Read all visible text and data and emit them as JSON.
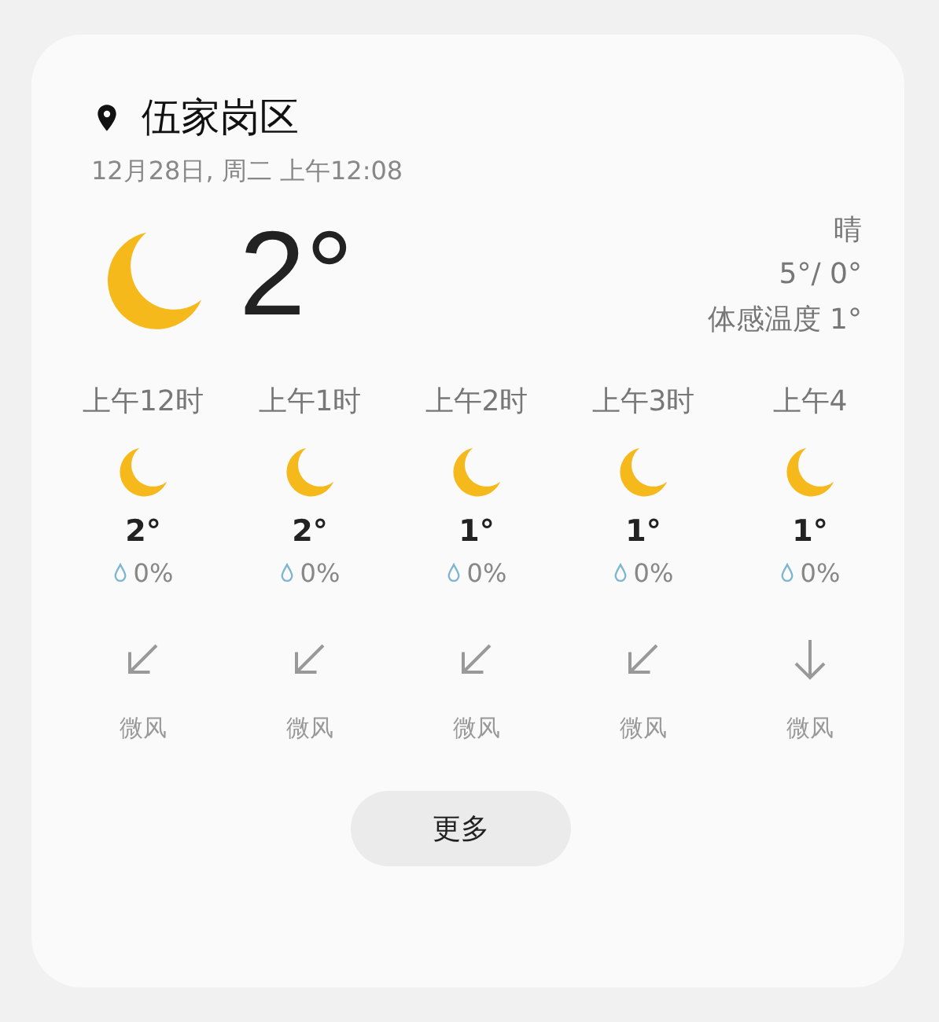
{
  "location": "伍家岗区",
  "datetime": "12月28日, 周二 上午12:08",
  "current": {
    "temperature": "2°",
    "condition": "晴",
    "high_low": "5°/ 0°",
    "feels_like": "体感温度 1°"
  },
  "hours": [
    {
      "time": "上午12时",
      "temperature": "2°",
      "precipitation": "0%",
      "kind": "southwest",
      "wind": "微风"
    },
    {
      "time": "上午1时",
      "temperature": "2°",
      "precipitation": "0%",
      "kind": "southwest",
      "wind": "微风"
    },
    {
      "time": "上午2时",
      "temperature": "1°",
      "precipitation": "0%",
      "kind": "southwest",
      "wind": "微风"
    },
    {
      "time": "上午3时",
      "temperature": "1°",
      "precipitation": "0%",
      "kind": "southwest",
      "wind": "微风"
    },
    {
      "time": "上午4",
      "temperature": "1°",
      "precipitation": "0%",
      "kind": "south",
      "wind": "微风"
    }
  ],
  "more_button": "更多"
}
